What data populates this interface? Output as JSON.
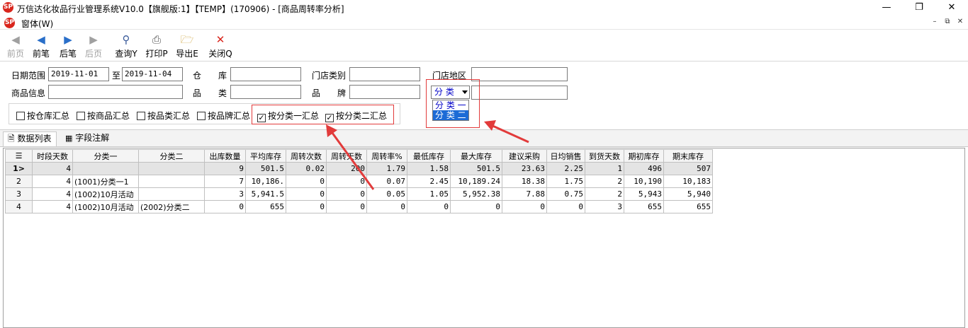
{
  "window": {
    "title": "万信达化妆品行业管理系统V10.0【旗舰版:1】【TEMP】(170906) - [商品周转率分析]",
    "logo_text": "SP"
  },
  "menu": {
    "label": "窗体(W)"
  },
  "toolbar": {
    "first": "前页",
    "prev": "前笔",
    "next": "后笔",
    "last": "后页",
    "query": "查询Y",
    "print": "打印P",
    "export": "导出E",
    "close": "关闭Q"
  },
  "filters": {
    "date_range_label": "日期范围",
    "date_from": "2019-11-01",
    "to_label": "至",
    "date_to": "2019-11-04",
    "warehouse_label": "仓　　库",
    "store_type_label": "门店类别",
    "store_region_label": "门店地区",
    "goods_info_label": "商品信息",
    "category_label": "品　　类",
    "brand_label": "品　　牌",
    "classify_select": "分 类",
    "classify_options": [
      "分 类 一",
      "分 类 二"
    ]
  },
  "checkboxes": [
    {
      "label": "按仓库汇总",
      "checked": false
    },
    {
      "label": "按商品汇总",
      "checked": false
    },
    {
      "label": "按品类汇总",
      "checked": false
    },
    {
      "label": "按品牌汇总",
      "checked": false
    },
    {
      "label": "按分类一汇总",
      "checked": true
    },
    {
      "label": "按分类二汇总",
      "checked": true
    }
  ],
  "tabs": [
    "数据列表",
    "字段注解"
  ],
  "grid": {
    "columns": [
      "时段天数",
      "分类一",
      "分类二",
      "出库数量",
      "平均库存",
      "周转次数",
      "周转天数",
      "周转率%",
      "最低库存",
      "最大库存",
      "建议采购",
      "日均销售",
      "到货天数",
      "期初库存",
      "期末库存"
    ],
    "rows": [
      {
        "rh": "1>",
        "cells": [
          "4",
          "",
          "",
          "9",
          "501.5",
          "0.02",
          "200",
          "1.79",
          "1.58",
          "501.5",
          "23.63",
          "2.25",
          "1",
          "496",
          "507"
        ]
      },
      {
        "rh": "2",
        "cells": [
          "4",
          "(1001)分类一1",
          "",
          "7",
          "10,186.",
          "0",
          "0",
          "0.07",
          "2.45",
          "10,189.24",
          "18.38",
          "1.75",
          "2",
          "10,190",
          "10,183"
        ]
      },
      {
        "rh": "3",
        "cells": [
          "4",
          "(1002)10月活动",
          "",
          "3",
          "5,941.5",
          "0",
          "0",
          "0.05",
          "1.05",
          "5,952.38",
          "7.88",
          "0.75",
          "2",
          "5,943",
          "5,940"
        ]
      },
      {
        "rh": "4",
        "cells": [
          "4",
          "(1002)10月活动",
          "(2002)分类二",
          "0",
          "655",
          "0",
          "0",
          "0",
          "0",
          "0",
          "0",
          "0",
          "3",
          "655",
          "655"
        ]
      }
    ]
  },
  "colors": {
    "accent_red": "#e23b3b",
    "select_blue": "#1c6bd6",
    "logo_red": "#d9251c"
  }
}
